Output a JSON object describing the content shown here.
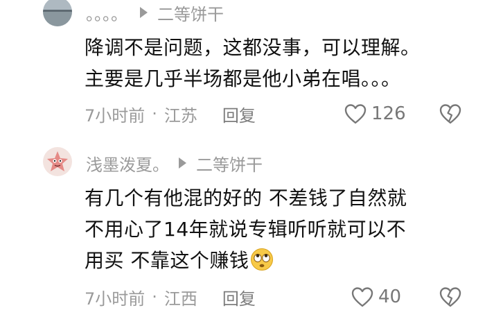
{
  "comments": [
    {
      "username": "。。。。",
      "reply_to": "二等饼干",
      "lines": [
        "降调不是问题，这都没事，可以理解。",
        "主要是几乎半场都是他小弟在唱。。。"
      ],
      "time": "7小时前",
      "dot": "·",
      "location": "江苏",
      "reply_label": "回复",
      "likes": "126"
    },
    {
      "username": "浅墨泼夏。",
      "reply_to": "二等饼干",
      "lines": [
        "有几个有他混的好的 不差钱了自然就",
        "不用心了14年就说专辑听听就可以不",
        "用买 不靠这个赚钱"
      ],
      "emoji": "rolling-eyes-emoji",
      "time": "7小时前",
      "dot": "·",
      "location": "江西",
      "reply_label": "回复",
      "likes": "40"
    }
  ]
}
